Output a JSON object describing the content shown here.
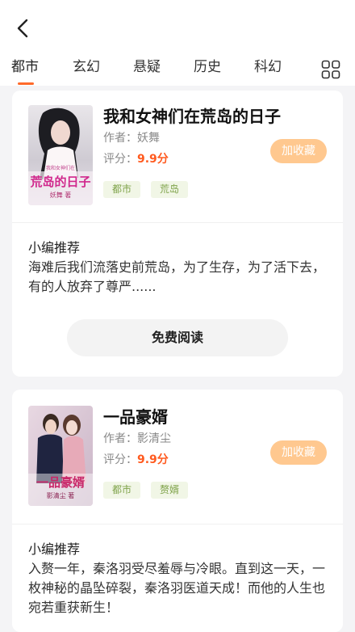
{
  "nav": {
    "back_icon": "chevron-left-icon",
    "tabs": [
      {
        "label": "都市"
      },
      {
        "label": "玄幻"
      },
      {
        "label": "悬疑"
      },
      {
        "label": "历史"
      },
      {
        "label": "科幻"
      }
    ],
    "active_tab_index": 0,
    "grid_icon": "grid-icon"
  },
  "books": [
    {
      "title": "我和女神们在荒岛的日子",
      "author_label": "作者：",
      "author": "妖舞",
      "score_label": "评分：",
      "score": "9.9分",
      "fav_label": "加收藏",
      "tags": [
        "都市",
        "荒岛"
      ],
      "cover_text": "荒岛的日子",
      "cover_subtext": "妖舞 著",
      "rec_label": "小编推荐",
      "rec_text": "海难后我们流落史前荒岛，为了生存，为了活下去，有的人放弃了尊严......",
      "read_label": "免费阅读"
    },
    {
      "title": "一品豪婿",
      "author_label": "作者：",
      "author": "影清尘",
      "score_label": "评分：",
      "score": "9.9分",
      "fav_label": "加收藏",
      "tags": [
        "都市",
        "赘婿"
      ],
      "cover_text": "一品豪婿",
      "cover_subtext": "影清尘 著",
      "rec_label": "小编推荐",
      "rec_text": "入赘一年，秦洛羽受尽羞辱与冷眼。直到这一天，一枚神秘的晶坠碎裂，秦洛羽医道天成！而他的人生也宛若重获新生！"
    }
  ],
  "colors": {
    "accent": "#ff6a2a",
    "score": "#ff5a1f",
    "fav_button": "#ffc88f",
    "tag_bg": "#f1f6e6",
    "tag_text": "#7fa34a"
  }
}
